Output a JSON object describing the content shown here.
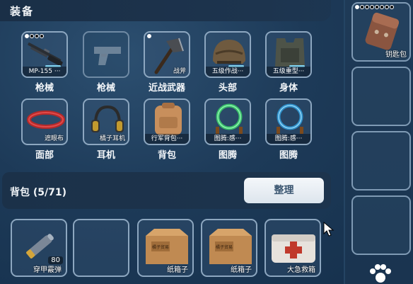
{
  "header": {
    "title": "装备"
  },
  "equipment": {
    "row1": [
      {
        "item": "MP-155 ···",
        "category": "枪械"
      },
      {
        "item": "",
        "category": "枪械"
      },
      {
        "item": "战斧",
        "category": "近战武器"
      },
      {
        "item": "五级作战···",
        "category": "头部"
      },
      {
        "item": "五级重型···",
        "category": "身体"
      }
    ],
    "row2": [
      {
        "item": "遮眼布",
        "category": "面部"
      },
      {
        "item": "橘子耳机",
        "category": "耳机"
      },
      {
        "item": "行军背包···",
        "category": "背包"
      },
      {
        "item": "图腾:感···",
        "category": "图腾"
      },
      {
        "item": "图腾:感···",
        "category": "图腾"
      }
    ]
  },
  "backpack": {
    "title": "背包 (5/71)",
    "sort_label": "整理",
    "items": [
      {
        "name": "穿甲霰弹",
        "qty": "80"
      },
      {
        "name": "",
        "qty": ""
      },
      {
        "name": "纸箱子",
        "qty": ""
      },
      {
        "name": "纸箱子",
        "qty": ""
      },
      {
        "name": "大急救箱",
        "qty": ""
      }
    ],
    "box_print": "橘子贸易"
  },
  "side": {
    "slots": [
      {
        "name": "钥匙包"
      },
      {
        "name": ""
      },
      {
        "name": ""
      },
      {
        "name": ""
      }
    ]
  },
  "icons": {
    "gun": "shotgun-icon",
    "pistol": "pistol-silhouette-icon",
    "axe": "axe-icon",
    "helmet": "helmet-icon",
    "armor": "body-armor-icon",
    "blindfold": "blindfold-icon",
    "headset": "headset-icon",
    "backpack": "backpack-icon",
    "totem": "totem-ring-icon",
    "shell": "shell-icon",
    "box": "cardboard-box-icon",
    "medkit": "medkit-icon",
    "keypouch": "key-pouch-icon",
    "paw": "paw-icon",
    "cursor": "mouse-cursor-icon"
  },
  "colors": {
    "accent": "#7fd0ee",
    "slot_border": "#8da7c0",
    "background": "#1d3a58"
  }
}
